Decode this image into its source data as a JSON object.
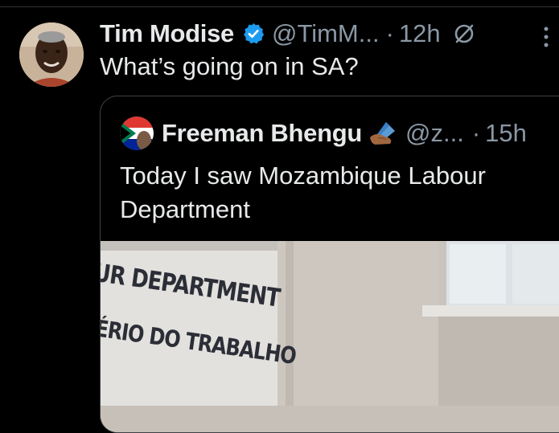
{
  "tweet": {
    "author_name": "Tim Modise",
    "handle": "@TimM...",
    "separator": "·",
    "time": "12h",
    "text": "What’s going on in SA?",
    "avatar_icon": "profile-photo",
    "verified_icon": "verified-badge-icon",
    "edited_icon": "edited-icon",
    "more_icon": "more-vertical-icon"
  },
  "quote": {
    "author_name": "Freeman Bhengu",
    "emoji": "✍🏾",
    "handle": "@z...",
    "separator": "·",
    "time": "15h",
    "text": "Today I saw Mozambique Labour Department",
    "media": {
      "sign_line1": "UR DEPARTMENT",
      "sign_line2": "ÉRIO DO TRABALHO"
    }
  },
  "colors": {
    "background": "#000000",
    "text_primary": "#e7e9ea",
    "text_secondary": "#8b98a5",
    "verified_blue": "#1d9bf0",
    "border": "#3e4144"
  }
}
